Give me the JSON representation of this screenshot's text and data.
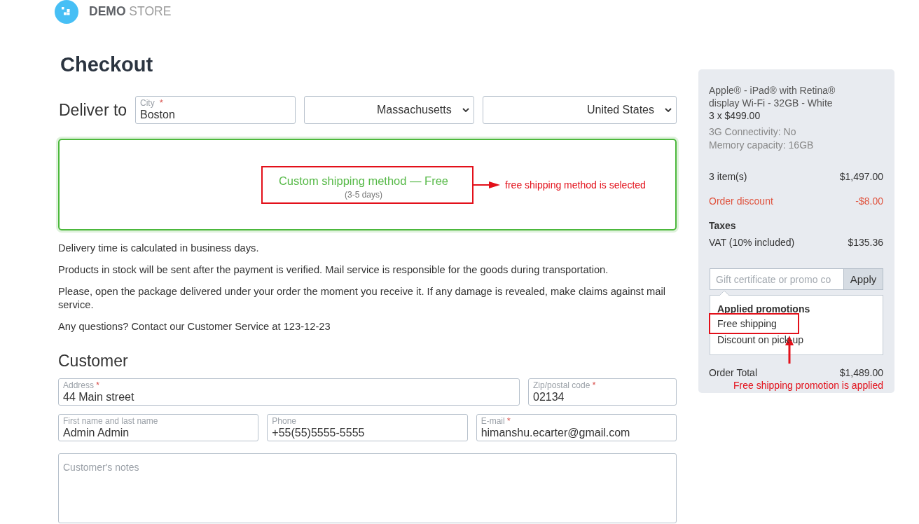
{
  "header": {
    "logo_text": "**DEMO** STORE"
  },
  "page_title": "Checkout",
  "delivery": {
    "label": "Deliver to",
    "city": {
      "label": "City",
      "required_mark": "*",
      "value": "Boston"
    },
    "state": {
      "value": "Massachusetts"
    },
    "country": {
      "value": "United States"
    }
  },
  "shipping_methods": [
    {
      "name": "Custom shipping method — Free",
      "duration": "(3-5 days)",
      "selected": true,
      "annotation": "free shipping method is selected"
    }
  ],
  "shipping_info": [
    "Delivery time is calculated in business days.",
    "Products in stock will be sent after the payment is verified. Mail service is responsible for the goods during transportation.",
    "Please, open the package delivered under your order the moment you receive it. If any damage is revealed, make claims against mail service.",
    "Any questions? Contact our Customer Service at 123-12-23"
  ],
  "customer": {
    "title": "Customer",
    "field_rows": [
      {
        "fields": [
          {
            "label": "Address",
            "required_mark": "*",
            "value": "44 Main street"
          },
          {
            "label": "Zip/postal code",
            "required_mark": "*",
            "value": "02134"
          }
        ]
      },
      {
        "fields": [
          {
            "label": "First name and last name",
            "value": "Admin Admin"
          },
          {
            "label": "Phone",
            "value": "+55(55)5555-5555"
          },
          {
            "label": "E-mail",
            "required_mark": "*",
            "value": "himanshu.ecarter@gmail.com"
          }
        ]
      }
    ],
    "notes": {
      "placeholder": "Customer's notes"
    }
  },
  "order_summary": {
    "product": {
      "name": "Apple® - iPad® with Retina® display Wi-Fi - 32GB - White",
      "quantity_price": "3 x $499.00",
      "options": [
        "3G Connectivity: No",
        "Memory capacity: 16GB"
      ]
    },
    "totals": [
      {
        "label": "3 item(s)",
        "value": "$1,497.00",
        "kind": "subtotal"
      },
      {
        "label": "Order discount",
        "value": "-$8.00",
        "kind": "discount"
      }
    ],
    "taxes": {
      "title": "Taxes",
      "items": [
        {
          "label": "VAT (10% included)",
          "value": "$135.36"
        }
      ]
    },
    "promo": {
      "placeholder": "Gift certificate or promo co",
      "button": "Apply"
    },
    "applied_promotions": {
      "title": "Applied promotions",
      "items": [
        {
          "name": "Free shipping",
          "annotated": true
        },
        {
          "name": "Discount on pick-up",
          "annotated": false
        }
      ]
    },
    "order_total": {
      "label": "Order Total",
      "value": "$1,489.00"
    },
    "annotation": "Free shipping promotion is applied"
  }
}
